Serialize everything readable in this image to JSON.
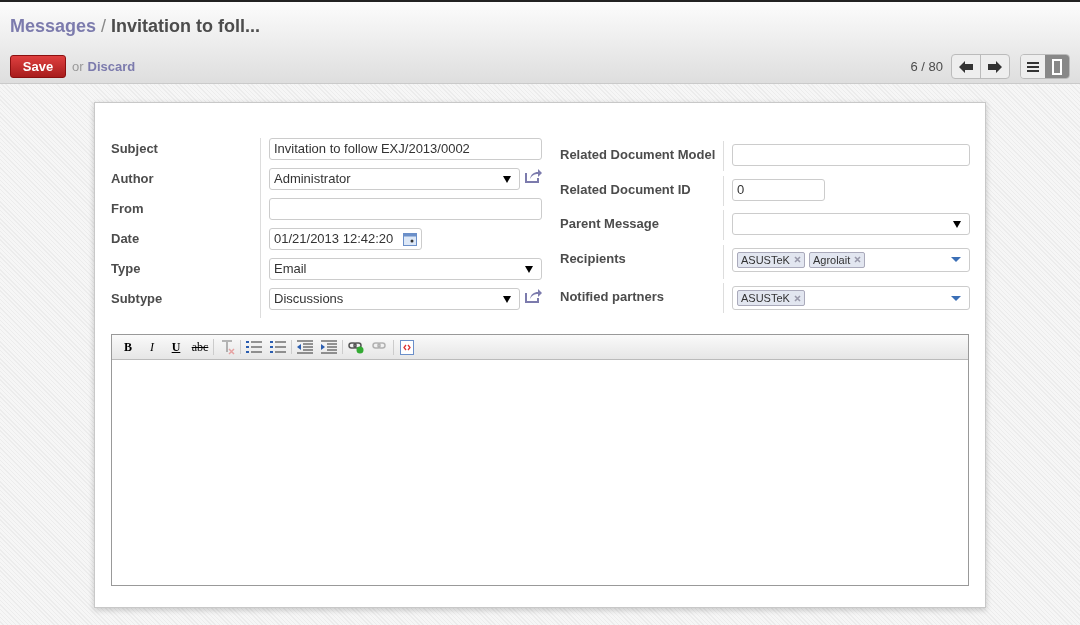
{
  "breadcrumb": {
    "parent": "Messages",
    "separator": "/",
    "current": "Invitation to foll..."
  },
  "actions": {
    "save": "Save",
    "or": "or",
    "discard": "Discard"
  },
  "pager": {
    "text": "6 / 80"
  },
  "views": [
    {
      "kind": "list",
      "selected": false
    },
    {
      "kind": "form",
      "selected": true
    }
  ],
  "left_fields": [
    {
      "label": "Subject",
      "kind": "text",
      "value": "Invitation to follow EXJ/2013/0002",
      "link": false
    },
    {
      "label": "Author",
      "kind": "select",
      "value": "Administrator",
      "link": true
    },
    {
      "label": "From",
      "kind": "text",
      "link": false
    },
    {
      "label": "Date",
      "kind": "date",
      "value": "01/21/2013 12:42:20",
      "link": false
    },
    {
      "label": "Type",
      "kind": "select",
      "value": "Email",
      "link": false
    },
    {
      "label": "Subtype",
      "kind": "select",
      "value": "Discussions",
      "link": true
    }
  ],
  "right_fields": [
    {
      "label": "Related Document Model",
      "kind": "text"
    },
    {
      "label": "Related Document ID",
      "kind": "short",
      "value": "0"
    },
    {
      "label": "Parent Message",
      "kind": "select"
    },
    {
      "label": "Recipients",
      "kind": "tags",
      "tags": [
        "ASUSTeK",
        "Agrolait"
      ]
    },
    {
      "label": "Notified partners",
      "kind": "tags",
      "tags": [
        "ASUSTeK"
      ]
    }
  ],
  "toolbar": [
    {
      "kind": "bold",
      "text": "B",
      "disabled": false
    },
    {
      "kind": "italic",
      "text": "I",
      "disabled": false
    },
    {
      "kind": "underline",
      "text": "U",
      "disabled": false
    },
    {
      "kind": "strike",
      "text": "abc",
      "disabled": false
    },
    {
      "kind": "clear",
      "disabled": true
    },
    {
      "kind": "bullets",
      "disabled": false
    },
    {
      "kind": "numbers",
      "disabled": false
    },
    {
      "kind": "outdent",
      "disabled": false
    },
    {
      "kind": "indent",
      "disabled": false
    },
    {
      "kind": "link",
      "disabled": false
    },
    {
      "kind": "unlink",
      "disabled": true
    },
    {
      "kind": "source",
      "disabled": false
    }
  ]
}
